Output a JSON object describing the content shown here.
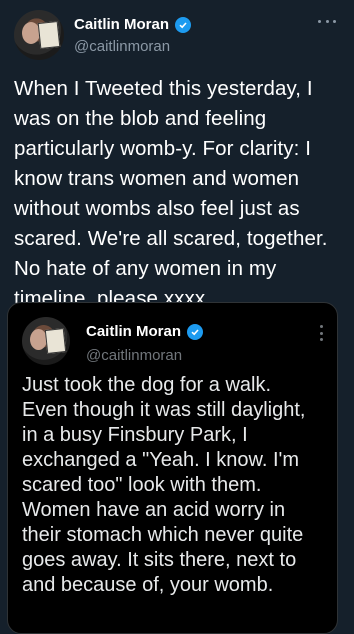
{
  "tweet": {
    "author": {
      "display_name": "Caitlin Moran",
      "handle": "@caitlinmoran",
      "verified": true
    },
    "text": "When I Tweeted this yesterday, I was on the blob and feeling particularly womb-y. For clarity: I know trans women and women without wombs also feel just as scared. We're all scared, together. No hate of any women in my timeline, please xxxx",
    "more_menu_icon": "more-horizontal-icon"
  },
  "quoted_tweet": {
    "author": {
      "display_name": "Caitlin Moran",
      "handle": "@caitlinmoran",
      "verified": true
    },
    "text": "Just took the dog for a walk. Even though it was still daylight, in a busy Finsbury Park, I exchanged a \"Yeah. I know. I'm scared too\" look with them. Women have an acid worry in their stomach which never quite goes away. It sits there, next to and because of, your womb.",
    "more_menu_icon": "more-vertical-icon"
  },
  "colors": {
    "background": "#15202b",
    "quote_background": "#000000",
    "verified_badge": "#1d9bf0",
    "secondary_text": "#8b98a5"
  }
}
